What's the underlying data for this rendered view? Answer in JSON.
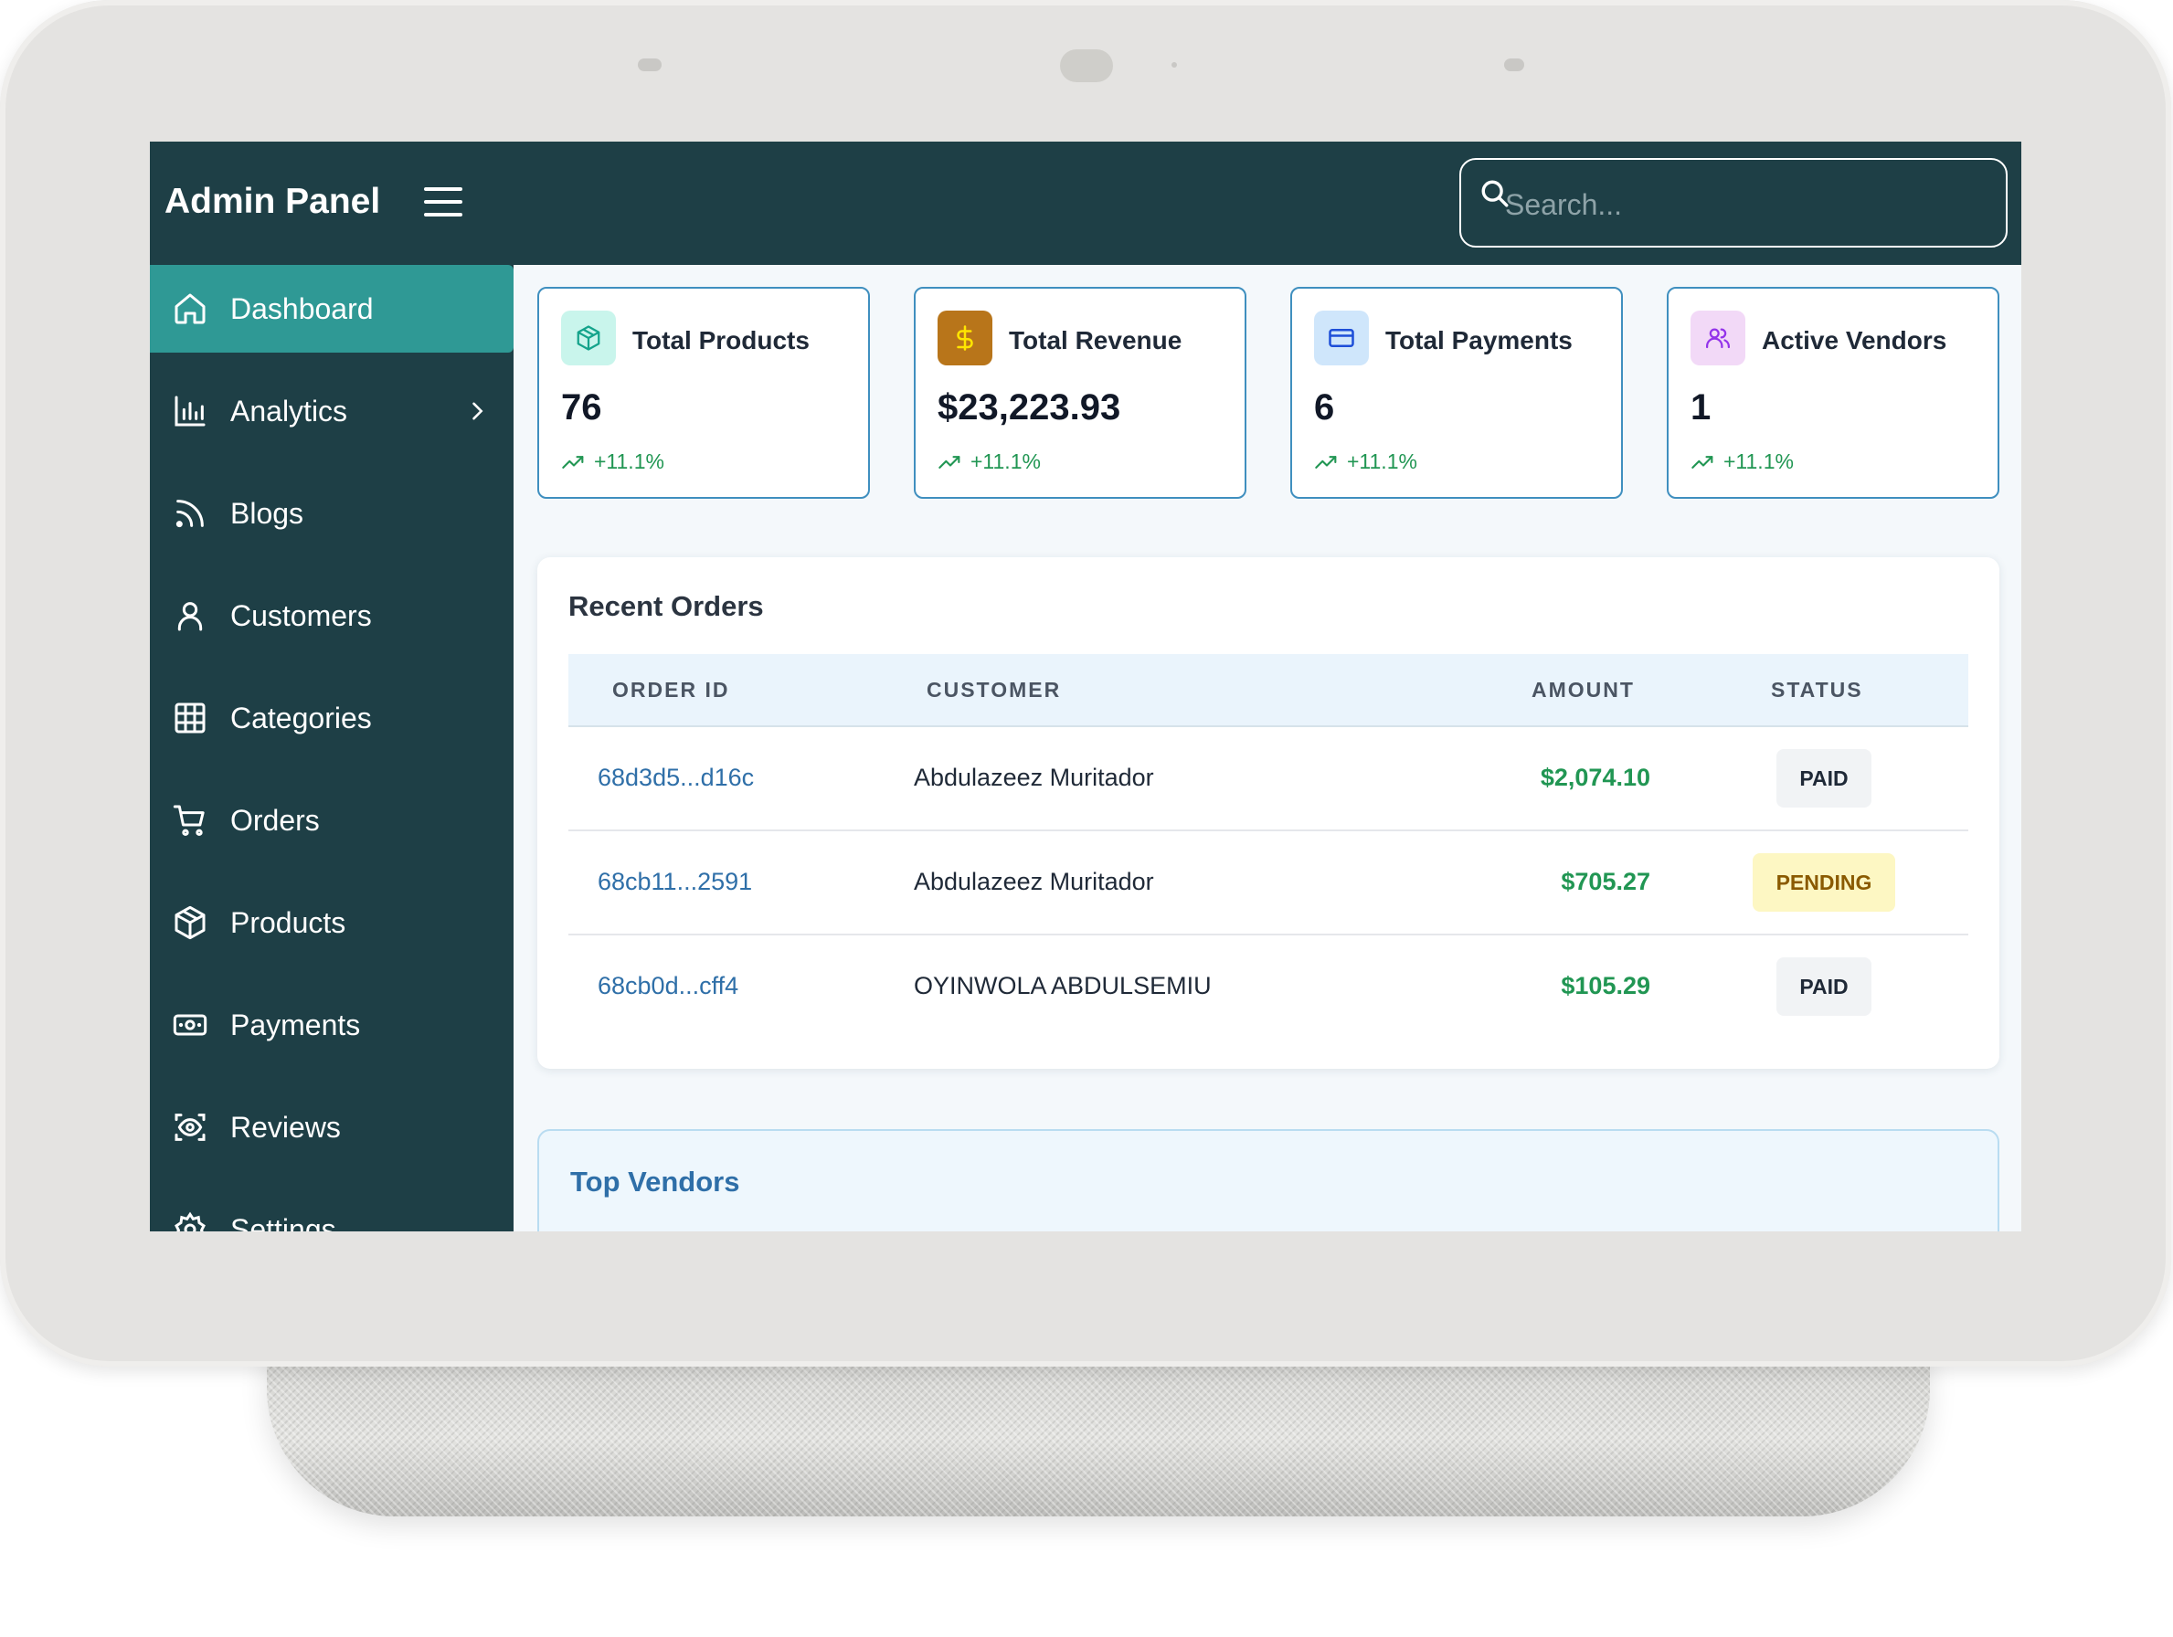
{
  "header": {
    "app_title": "Admin Panel",
    "search_placeholder": "Search..."
  },
  "sidebar": {
    "items": [
      {
        "label": "Dashboard",
        "icon": "home-icon",
        "active": true
      },
      {
        "label": "Analytics",
        "icon": "bar-chart-icon",
        "has_submenu": true
      },
      {
        "label": "Blogs",
        "icon": "rss-icon"
      },
      {
        "label": "Customers",
        "icon": "user-icon"
      },
      {
        "label": "Categories",
        "icon": "grid-icon"
      },
      {
        "label": "Orders",
        "icon": "cart-icon"
      },
      {
        "label": "Products",
        "icon": "box-icon"
      },
      {
        "label": "Payments",
        "icon": "banknote-icon"
      },
      {
        "label": "Reviews",
        "icon": "eye-scan-icon"
      },
      {
        "label": "Settings",
        "icon": "gear-icon"
      }
    ]
  },
  "stats": [
    {
      "title": "Total Products",
      "value": "76",
      "trend": "+11.1%",
      "icon": "box-icon",
      "icon_bg": "#c9f5ec",
      "icon_color": "#14a38b"
    },
    {
      "title": "Total Revenue",
      "value": "$23,223.93",
      "trend": "+11.1%",
      "icon": "dollar-icon",
      "icon_bg": "#b8751a",
      "icon_color": "#ffe600"
    },
    {
      "title": "Total Payments",
      "value": "6",
      "trend": "+11.1%",
      "icon": "credit-card-icon",
      "icon_bg": "#cfe6fb",
      "icon_color": "#1d4ed8"
    },
    {
      "title": "Active Vendors",
      "value": "1",
      "trend": "+11.1%",
      "icon": "users-icon",
      "icon_bg": "#f2d9f7",
      "icon_color": "#9333ea"
    }
  ],
  "recent_orders": {
    "title": "Recent Orders",
    "columns": [
      "ORDER ID",
      "CUSTOMER",
      "AMOUNT",
      "STATUS"
    ],
    "rows": [
      {
        "order_id": "68d3d5...d16c",
        "customer": "Abdulazeez Muritador",
        "amount": "$2,074.10",
        "status": "PAID"
      },
      {
        "order_id": "68cb11...2591",
        "customer": "Abdulazeez Muritador",
        "amount": "$705.27",
        "status": "PENDING"
      },
      {
        "order_id": "68cb0d...cff4",
        "customer": "OYINWOLA ABDULSEMIU",
        "amount": "$105.29",
        "status": "PAID"
      }
    ]
  },
  "top_vendors": {
    "title": "Top Vendors"
  },
  "colors": {
    "sidebar_bg": "#1e3f46",
    "active_item_bg": "#2f9995",
    "positive": "#219653",
    "link": "#2f6fa8"
  }
}
